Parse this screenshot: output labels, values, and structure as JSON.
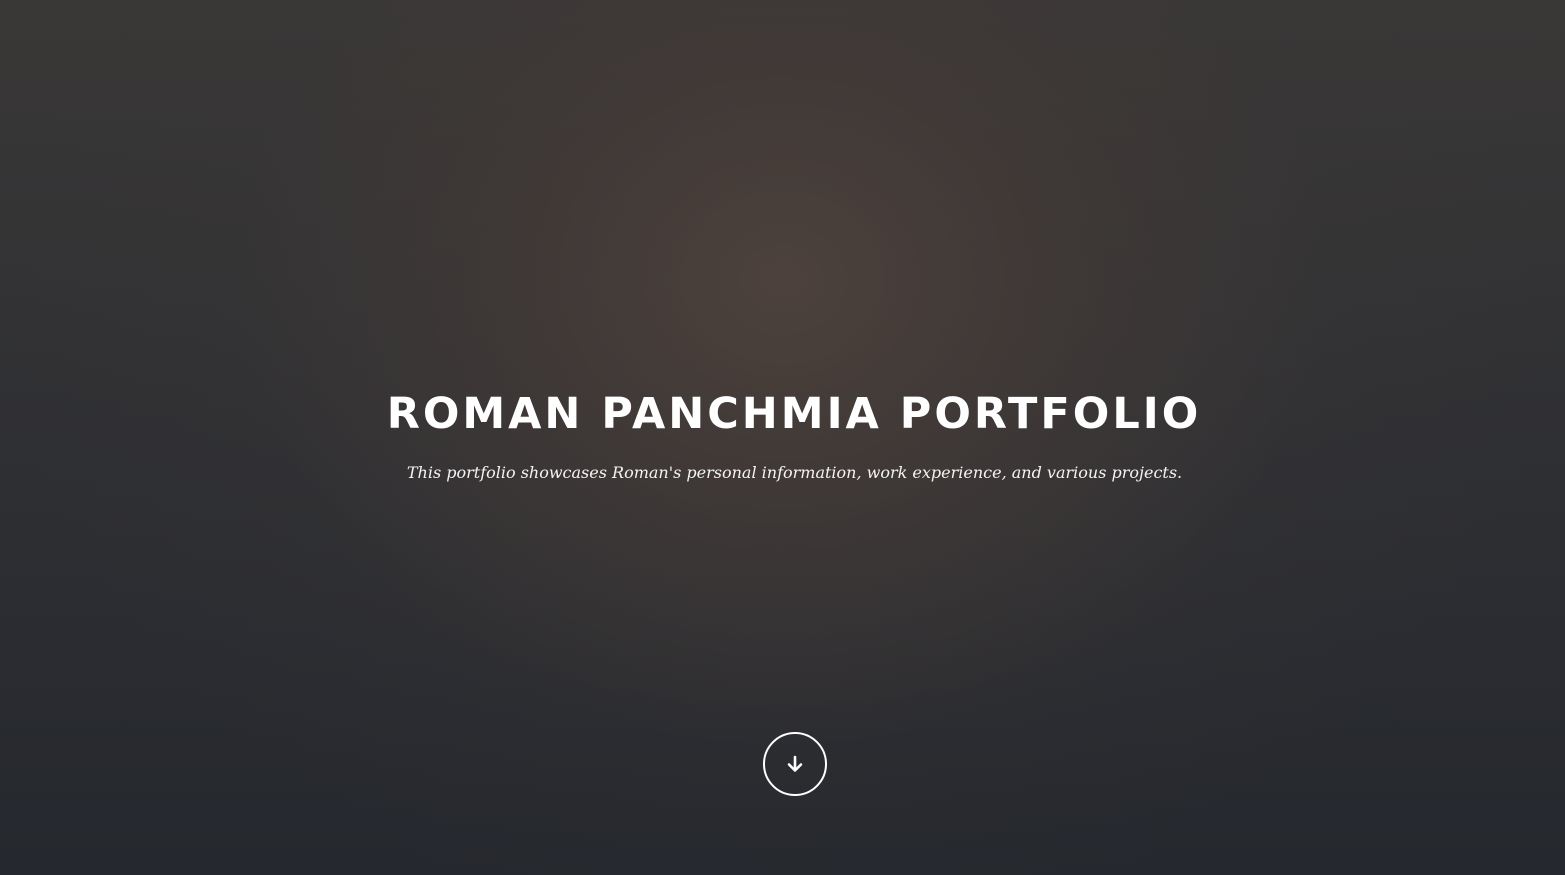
{
  "hero": {
    "title": "ROMAN PANCHMIA PORTFOLIO",
    "subtitle": "This portfolio showcases Roman's personal information, work experience, and various projects.",
    "scroll_icon": "arrow-down-icon"
  },
  "colors": {
    "text": "#ffffff",
    "background_dark": "#2a2d33",
    "background_warm": "#4e423c"
  }
}
